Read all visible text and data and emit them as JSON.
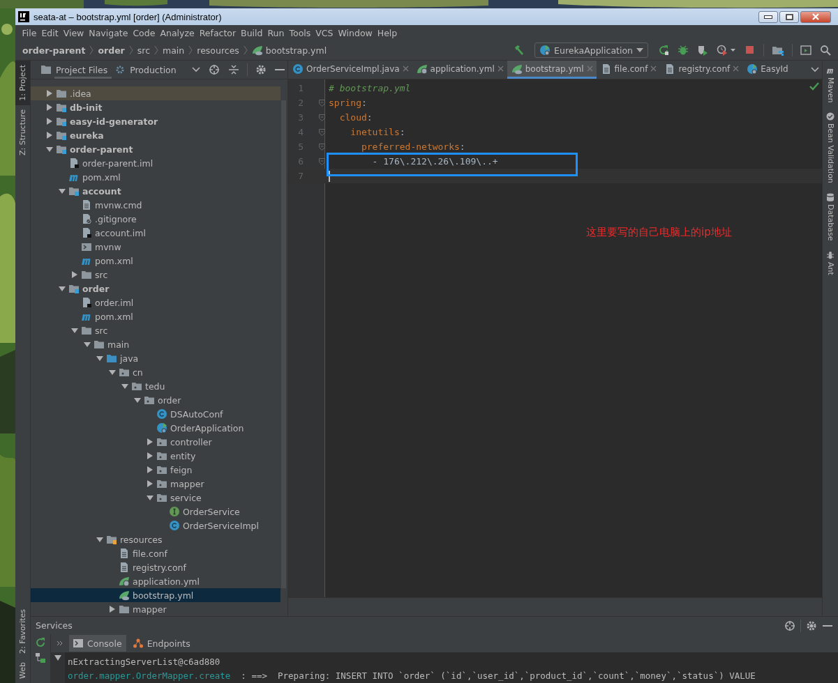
{
  "window": {
    "title": "seata-at – bootstrap.yml [order] (Administrator)"
  },
  "menu": [
    "File",
    "Edit",
    "View",
    "Navigate",
    "Code",
    "Analyze",
    "Refactor",
    "Build",
    "Run",
    "Tools",
    "VCS",
    "Window",
    "Help"
  ],
  "breadcrumbs": [
    {
      "label": "order-parent",
      "bold": true
    },
    {
      "label": "order",
      "bold": true
    },
    {
      "label": "src",
      "bold": false
    },
    {
      "label": "main",
      "bold": false
    },
    {
      "label": "resources",
      "bold": false
    },
    {
      "label": "bootstrap.yml",
      "bold": false,
      "kind": "yml"
    }
  ],
  "run_config": "EurekaApplication",
  "left_tool_windows": [
    {
      "label": "1: Project",
      "selected": true
    },
    {
      "label": "Z: Structure",
      "selected": false
    }
  ],
  "left_tool_windows_bottom": [
    {
      "label": "2: Favorites",
      "selected": false
    },
    {
      "label": "Web",
      "selected": false
    }
  ],
  "right_tool_windows": [
    {
      "label": "Maven",
      "kind": "maven"
    },
    {
      "label": "Bean Validation",
      "kind": "bean"
    },
    {
      "label": "Database",
      "kind": "database"
    },
    {
      "label": "Ant",
      "kind": "ant"
    }
  ],
  "project_scopes": [
    {
      "label": "Project Files",
      "selected": true
    },
    {
      "label": "Production",
      "selected": false
    }
  ],
  "tree": [
    {
      "name": ".idea",
      "kind": "folder",
      "bold": false,
      "expanded": false,
      "selected": false,
      "ignored": true
    },
    {
      "name": "db-init",
      "kind": "module",
      "bold": true,
      "expanded": false,
      "selected": false,
      "ignored": false
    },
    {
      "name": "easy-id-generator",
      "kind": "module",
      "bold": true,
      "expanded": false,
      "selected": false,
      "ignored": false
    },
    {
      "name": "eureka",
      "kind": "module",
      "bold": true,
      "expanded": false,
      "selected": false,
      "ignored": false
    },
    {
      "name": "order-parent",
      "kind": "module",
      "bold": true,
      "expanded": true,
      "selected": false,
      "ignored": false,
      "children": [
        {
          "name": "order-parent.iml",
          "kind": "iml",
          "bold": false,
          "selected": false,
          "ignored": false
        },
        {
          "name": "pom.xml",
          "kind": "maven",
          "bold": false,
          "selected": false,
          "ignored": false
        },
        {
          "name": "account",
          "kind": "module",
          "bold": true,
          "expanded": true,
          "selected": false,
          "ignored": false,
          "children": [
            {
              "name": "mvnw.cmd",
              "kind": "text",
              "bold": false,
              "selected": false,
              "ignored": false
            },
            {
              "name": ".gitignore",
              "kind": "ignore",
              "bold": false,
              "selected": false,
              "ignored": false
            },
            {
              "name": "account.iml",
              "kind": "iml",
              "bold": false,
              "selected": false,
              "ignored": false
            },
            {
              "name": "mvnw",
              "kind": "script",
              "bold": false,
              "selected": false,
              "ignored": false
            },
            {
              "name": "pom.xml",
              "kind": "maven",
              "bold": false,
              "selected": false,
              "ignored": false
            },
            {
              "name": "src",
              "kind": "folder",
              "bold": false,
              "expanded": false,
              "selected": false,
              "ignored": false
            }
          ]
        },
        {
          "name": "order",
          "kind": "module",
          "bold": true,
          "expanded": true,
          "selected": false,
          "ignored": false,
          "children": [
            {
              "name": "order.iml",
              "kind": "iml",
              "bold": false,
              "selected": false,
              "ignored": false
            },
            {
              "name": "pom.xml",
              "kind": "maven",
              "bold": false,
              "selected": false,
              "ignored": false
            },
            {
              "name": "src",
              "kind": "folder",
              "bold": false,
              "expanded": true,
              "selected": false,
              "ignored": false,
              "children": [
                {
                  "name": "main",
                  "kind": "folder",
                  "bold": false,
                  "expanded": true,
                  "selected": false,
                  "ignored": false,
                  "children": [
                    {
                      "name": "java",
                      "kind": "source",
                      "bold": false,
                      "expanded": true,
                      "selected": false,
                      "ignored": false,
                      "children": [
                        {
                          "name": "cn",
                          "kind": "package",
                          "bold": false,
                          "expanded": true,
                          "selected": false,
                          "ignored": false,
                          "children": [
                            {
                              "name": "tedu",
                              "kind": "package",
                              "bold": false,
                              "expanded": true,
                              "selected": false,
                              "ignored": false,
                              "children": [
                                {
                                  "name": "order",
                                  "kind": "package",
                                  "bold": false,
                                  "expanded": true,
                                  "selected": false,
                                  "ignored": false,
                                  "children": [
                                    {
                                      "name": "DSAutoConf",
                                      "kind": "class",
                                      "bold": false,
                                      "selected": false,
                                      "ignored": false
                                    },
                                    {
                                      "name": "OrderApplication",
                                      "kind": "spring-class",
                                      "bold": false,
                                      "selected": false,
                                      "ignored": false
                                    },
                                    {
                                      "name": "controller",
                                      "kind": "package",
                                      "bold": false,
                                      "expanded": false,
                                      "selected": false,
                                      "ignored": false
                                    },
                                    {
                                      "name": "entity",
                                      "kind": "package",
                                      "bold": false,
                                      "expanded": false,
                                      "selected": false,
                                      "ignored": false
                                    },
                                    {
                                      "name": "feign",
                                      "kind": "package",
                                      "bold": false,
                                      "expanded": false,
                                      "selected": false,
                                      "ignored": false
                                    },
                                    {
                                      "name": "mapper",
                                      "kind": "package",
                                      "bold": false,
                                      "expanded": false,
                                      "selected": false,
                                      "ignored": false
                                    },
                                    {
                                      "name": "service",
                                      "kind": "package",
                                      "bold": false,
                                      "expanded": true,
                                      "selected": false,
                                      "ignored": false,
                                      "children": [
                                        {
                                          "name": "OrderService",
                                          "kind": "interface",
                                          "bold": false,
                                          "selected": false,
                                          "ignored": false
                                        },
                                        {
                                          "name": "OrderServiceImpl",
                                          "kind": "class",
                                          "bold": false,
                                          "selected": false,
                                          "ignored": false
                                        }
                                      ]
                                    }
                                  ]
                                }
                              ]
                            }
                          ]
                        }
                      ]
                    },
                    {
                      "name": "resources",
                      "kind": "resources",
                      "bold": false,
                      "expanded": true,
                      "selected": false,
                      "ignored": false,
                      "children": [
                        {
                          "name": "file.conf",
                          "kind": "text",
                          "bold": false,
                          "selected": false,
                          "ignored": false
                        },
                        {
                          "name": "registry.conf",
                          "kind": "text",
                          "bold": false,
                          "selected": false,
                          "ignored": false
                        },
                        {
                          "name": "application.yml",
                          "kind": "yml-app",
                          "bold": false,
                          "selected": false,
                          "ignored": false
                        },
                        {
                          "name": "bootstrap.yml",
                          "kind": "yml",
                          "bold": false,
                          "selected": true,
                          "ignored": false
                        },
                        {
                          "name": "mapper",
                          "kind": "folder",
                          "bold": false,
                          "expanded": false,
                          "selected": false,
                          "ignored": false
                        }
                      ]
                    }
                  ]
                }
              ]
            }
          ]
        }
      ]
    }
  ],
  "editor_tabs": [
    {
      "label": "OrderServiceImpl.java",
      "kind": "class",
      "selected": false
    },
    {
      "label": "application.yml",
      "kind": "yml-app",
      "selected": false
    },
    {
      "label": "bootstrap.yml",
      "kind": "yml",
      "selected": true
    },
    {
      "label": "file.conf",
      "kind": "text",
      "selected": false
    },
    {
      "label": "registry.conf",
      "kind": "text",
      "selected": false
    },
    {
      "label": "EasyId",
      "kind": "boot",
      "selected": false
    }
  ],
  "code_lines": [
    {
      "number": "1",
      "kind": "comment",
      "text": "# bootstrap.yml",
      "fold": false,
      "current": false
    },
    {
      "number": "2",
      "kind": "key",
      "text": "spring:",
      "fold": true,
      "current": false
    },
    {
      "number": "3",
      "kind": "key",
      "text": "  cloud:",
      "fold": true,
      "current": false
    },
    {
      "number": "4",
      "kind": "key",
      "text": "    inetutils:",
      "fold": true,
      "current": false
    },
    {
      "number": "5",
      "kind": "key",
      "text": "      preferred-networks:",
      "fold": true,
      "current": false
    },
    {
      "number": "6",
      "kind": "value",
      "text": "        - 176\\.212\\.26\\.109\\..+",
      "fold": true,
      "current": false
    },
    {
      "number": "7",
      "kind": "empty",
      "fold": false,
      "current": true
    }
  ],
  "annotation": "这里要写的自己电脑上的ip地址",
  "services": {
    "title": "Services",
    "tabs": [
      {
        "label": "Console",
        "kind": "console",
        "selected": true
      },
      {
        "label": "Endpoints",
        "kind": "endpoints",
        "selected": false
      }
    ],
    "console_lines": [
      {
        "message": "nExtractingServerList@c6ad880"
      },
      {
        "source": "order.mapper.OrderMapper.create",
        "message": "  : ==>  Preparing: INSERT INTO `order` (`id`,`user_id`,`product_id`,`count`,`money`,`status`) VALUE"
      }
    ]
  }
}
